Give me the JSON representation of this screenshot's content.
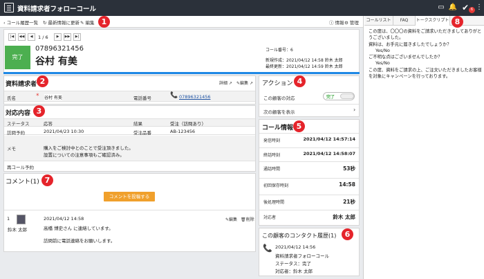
{
  "topbar": {
    "title": "資料請求者フォローコール",
    "badge": "6"
  },
  "toolbar": {
    "back": "コール履歴一覧",
    "refresh": "最新情報に更新",
    "edit": "編集",
    "info": "情報",
    "manage": "管理"
  },
  "pager": {
    "text": "1 / 6"
  },
  "header": {
    "status": "完了",
    "phone": "07896321456",
    "name": "谷村 有美",
    "call_no": "コール番号：6",
    "created": "新規作成：2021/04/12 14:58 鈴木 太郎",
    "updated": "最終更新：2021/04/12 14:59 鈴木 太郎"
  },
  "requester": {
    "title": "資料請求者",
    "detail": "詳細",
    "edit": "編集",
    "name_label": "氏名",
    "name_value": "谷村 有美",
    "phone_label": "電話番号",
    "phone_value": "07896321456"
  },
  "response": {
    "title": "対応内容",
    "status_label": "ステータス",
    "status_value": "応答",
    "result_label": "結果",
    "result_value": "受注（訪問あり）",
    "visit_label": "訪問予約",
    "visit_value": "2021/04/23 10:30",
    "order_label": "受注品番",
    "order_value": "AB-123456",
    "memo_label": "メモ",
    "memo_line1": "購入をご検討中とのことで受注頂きました。",
    "memo_line2": "設置についての注意事項もご確認済み。",
    "recall_label": "再コール予約"
  },
  "comments": {
    "title": "コメント(1)",
    "add_button": "コメントを投稿する",
    "index": "1",
    "author": "鈴木 太郎",
    "date": "2021/04/12 14:58",
    "edit": "編集",
    "delete": "削除",
    "line1": "高橋 博史さん に連絡しています。",
    "line2": "訪問前に電話連絡をお願いします。"
  },
  "action": {
    "title": "アクション",
    "customer_label": "この顧客の対応",
    "toggle_on": "完了",
    "next": "次の顧客を表示"
  },
  "call_info": {
    "title": "コール情報",
    "rows": [
      {
        "label": "発信時刻",
        "value": "2021/04/12 14:57:14"
      },
      {
        "label": "終話時刻",
        "value": "2021/04/12 14:58:07"
      },
      {
        "label": "通話時間",
        "value": "53秒"
      },
      {
        "label": "初回保存時刻",
        "value": "14:58"
      },
      {
        "label": "後処理時間",
        "value": "21秒"
      },
      {
        "label": "対応者",
        "value": "鈴木 太郎"
      }
    ]
  },
  "contact_history": {
    "title": "この顧客のコンタクト履歴(1)",
    "date": "2021/04/12 14:56",
    "campaign": "資料請求者フォローコール",
    "status": "ステータス：完了",
    "person": "対応者：鈴木 太郎"
  },
  "right_tabs": {
    "tab1": "コールリスト",
    "tab2": "FAQ",
    "tab3": "トークスクリプト"
  },
  "script": {
    "l1": "この度は、〇〇〇の資料をご請求いただきましてありがと",
    "l2": "うございました。",
    "l3": "資料は、お手元に届きましたでしょうか？",
    "l4": "Yes/No",
    "l5": "ご不明な点はございませんでしたか？",
    "l6": "Yes/No",
    "l7": "この度、資料をご請求の上、ご注文いただきましたお客様",
    "l8": "を対象にキャンペーンを行っております。"
  },
  "callouts": {
    "c1": "1",
    "c2": "2",
    "c3": "3",
    "c4": "4",
    "c5": "5",
    "c6": "6",
    "c7": "7",
    "c8": "8"
  }
}
